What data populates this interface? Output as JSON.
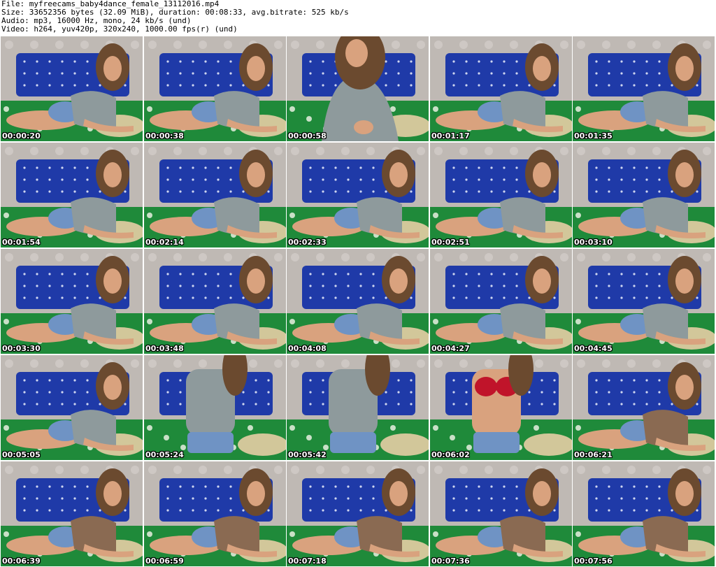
{
  "header": {
    "line1": "File: myfreecams_baby4dance_female_13112016.mp4",
    "line2": "Size: 33652356 bytes (32.09 MiB), duration: 00:08:33, avg.bitrate: 525 kb/s",
    "line3": "Audio: mp3, 16000 Hz, mono, 24 kb/s (und)",
    "line4": "Video: h264, yuv420p, 320x240, 1000.00 fps(r) (und)"
  },
  "colors": {
    "wallpaper": "#bfb9b4",
    "headboard": "#1f3aa8",
    "blanket": "#1f8a3a",
    "pillow": "#d2c79a",
    "skin": "#d9a27e",
    "hair": "#6b4a2f",
    "top_gray": "#8e9a9c",
    "dress_brown": "#8a6a52",
    "denim": "#6f93c4",
    "bra_red": "#c0142a"
  },
  "thumbnails": [
    {
      "time": "00:00:20",
      "top": "top_gray",
      "pose": "lying"
    },
    {
      "time": "00:00:38",
      "top": "top_gray",
      "pose": "lying"
    },
    {
      "time": "00:00:58",
      "top": "top_gray",
      "pose": "close"
    },
    {
      "time": "00:01:17",
      "top": "top_gray",
      "pose": "lying"
    },
    {
      "time": "00:01:35",
      "top": "top_gray",
      "pose": "lying"
    },
    {
      "time": "00:01:54",
      "top": "top_gray",
      "pose": "lying"
    },
    {
      "time": "00:02:14",
      "top": "top_gray",
      "pose": "lying"
    },
    {
      "time": "00:02:33",
      "top": "top_gray",
      "pose": "lying"
    },
    {
      "time": "00:02:51",
      "top": "top_gray",
      "pose": "lying"
    },
    {
      "time": "00:03:10",
      "top": "top_gray",
      "pose": "lying"
    },
    {
      "time": "00:03:30",
      "top": "top_gray",
      "pose": "lying"
    },
    {
      "time": "00:03:48",
      "top": "top_gray",
      "pose": "lying"
    },
    {
      "time": "00:04:08",
      "top": "top_gray",
      "pose": "lying"
    },
    {
      "time": "00:04:27",
      "top": "top_gray",
      "pose": "lying"
    },
    {
      "time": "00:04:45",
      "top": "top_gray",
      "pose": "lying"
    },
    {
      "time": "00:05:05",
      "top": "top_gray",
      "pose": "lying"
    },
    {
      "time": "00:05:24",
      "top": "top_gray",
      "pose": "standing"
    },
    {
      "time": "00:05:42",
      "top": "top_gray",
      "pose": "standing"
    },
    {
      "time": "00:06:02",
      "top": "bra_red",
      "pose": "standing"
    },
    {
      "time": "00:06:21",
      "top": "dress_brown",
      "pose": "lying"
    },
    {
      "time": "00:06:39",
      "top": "dress_brown",
      "pose": "lying"
    },
    {
      "time": "00:06:59",
      "top": "dress_brown",
      "pose": "lying"
    },
    {
      "time": "00:07:18",
      "top": "dress_brown",
      "pose": "lying"
    },
    {
      "time": "00:07:36",
      "top": "dress_brown",
      "pose": "lying"
    },
    {
      "time": "00:07:56",
      "top": "dress_brown",
      "pose": "lying"
    }
  ]
}
